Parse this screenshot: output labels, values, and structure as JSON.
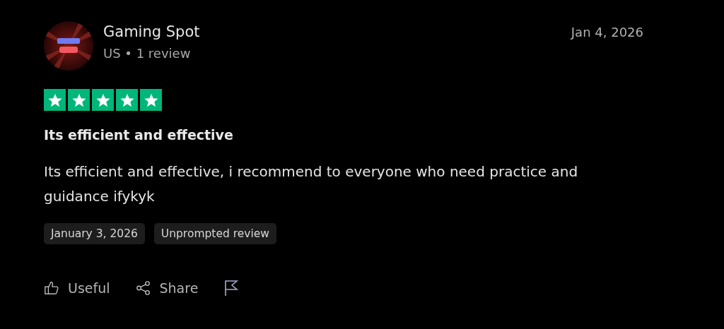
{
  "review": {
    "avatar": {
      "kind": "picture"
    },
    "author": "Gaming Spot",
    "meta": "US • 1 review",
    "date": "Jan 4, 2026",
    "stars": 5,
    "title": "Its efficient and effective",
    "body": "Its efficient and effective, i recommend to everyone who need practice and guidance ifykyk",
    "tags": [
      "January 3, 2026",
      "Unprompted review"
    ],
    "actions": [
      {
        "kind": "useful",
        "label": "Useful"
      },
      {
        "kind": "share",
        "label": "Share"
      },
      {
        "kind": "flag"
      }
    ]
  }
}
